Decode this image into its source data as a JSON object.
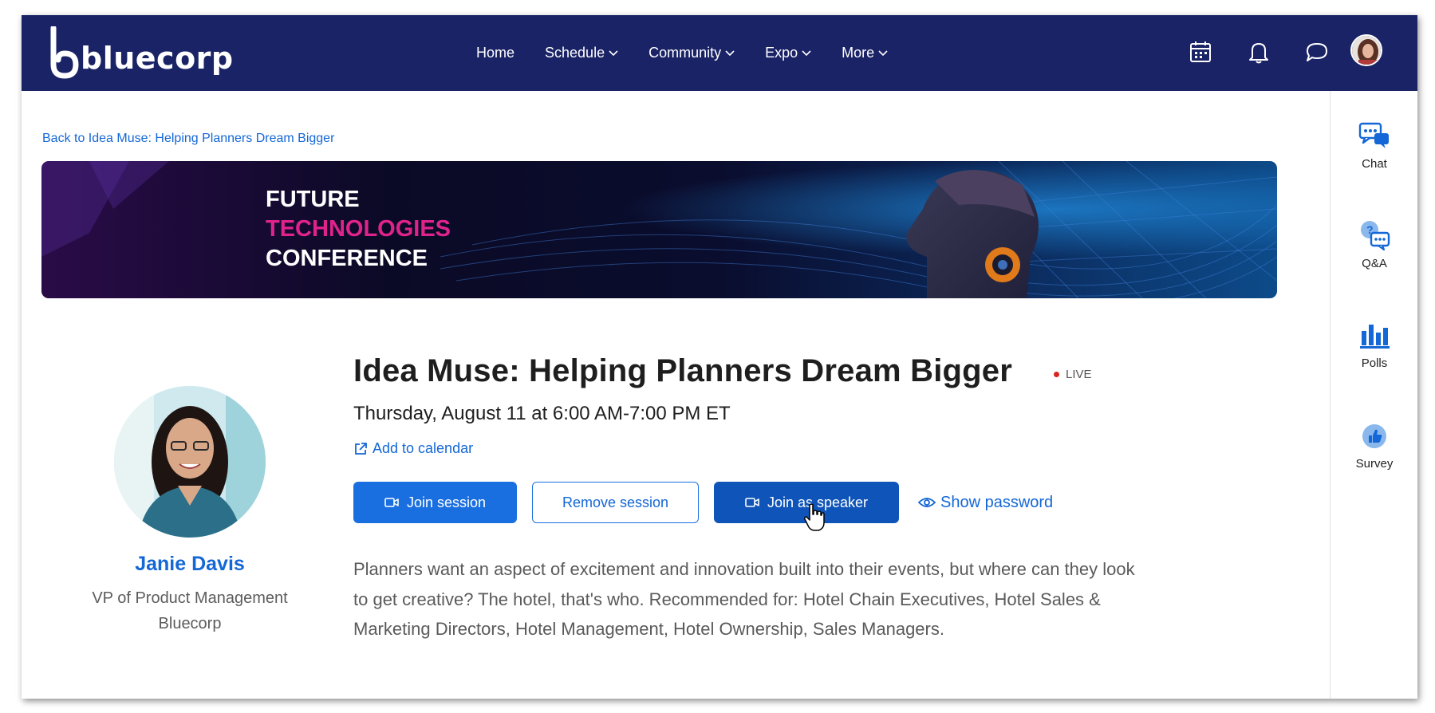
{
  "brand": {
    "name": "bluecorp"
  },
  "nav": {
    "items": [
      {
        "label": "Home",
        "has_dropdown": false
      },
      {
        "label": "Schedule",
        "has_dropdown": true
      },
      {
        "label": "Community",
        "has_dropdown": true
      },
      {
        "label": "Expo",
        "has_dropdown": true
      },
      {
        "label": "More",
        "has_dropdown": true
      }
    ],
    "icons": [
      "calendar-icon",
      "bell-icon",
      "chat-bubble-icon",
      "user-avatar"
    ]
  },
  "back_link": "Back to Idea Muse: Helping Planners Dream Bigger",
  "banner": {
    "line1": "FUTURE",
    "line2": "TECHNOLOGIES",
    "line3": "CONFERENCE"
  },
  "speaker": {
    "name": "Janie Davis",
    "title": "VP of Product Management",
    "organization": "Bluecorp"
  },
  "session": {
    "title": "Idea Muse: Helping Planners Dream Bigger",
    "status": "LIVE",
    "datetime": "Thursday, August 11 at 6:00 AM-7:00 PM ET",
    "add_calendar": "Add to calendar",
    "description": "Planners want an aspect of excitement and innovation built into their events, but where can they look to get creative? The hotel, that's who. Recommended for: Hotel Chain Executives, Hotel Sales & Marketing Directors, Hotel Management, Hotel Ownership, Sales Managers."
  },
  "actions": {
    "join_session": "Join session",
    "remove_session": "Remove session",
    "join_speaker": "Join as speaker",
    "show_password": "Show password"
  },
  "rail": [
    {
      "label": "Chat",
      "icon": "chat-icon"
    },
    {
      "label": "Q&A",
      "icon": "qa-icon"
    },
    {
      "label": "Polls",
      "icon": "polls-icon"
    },
    {
      "label": "Survey",
      "icon": "survey-icon"
    }
  ],
  "colors": {
    "nav_bg": "#1a2366",
    "primary": "#1a6fe0",
    "primary_dark": "#0f54b8",
    "link": "#1467d6",
    "banner_accent": "#e0238c",
    "live": "#d7261e"
  }
}
